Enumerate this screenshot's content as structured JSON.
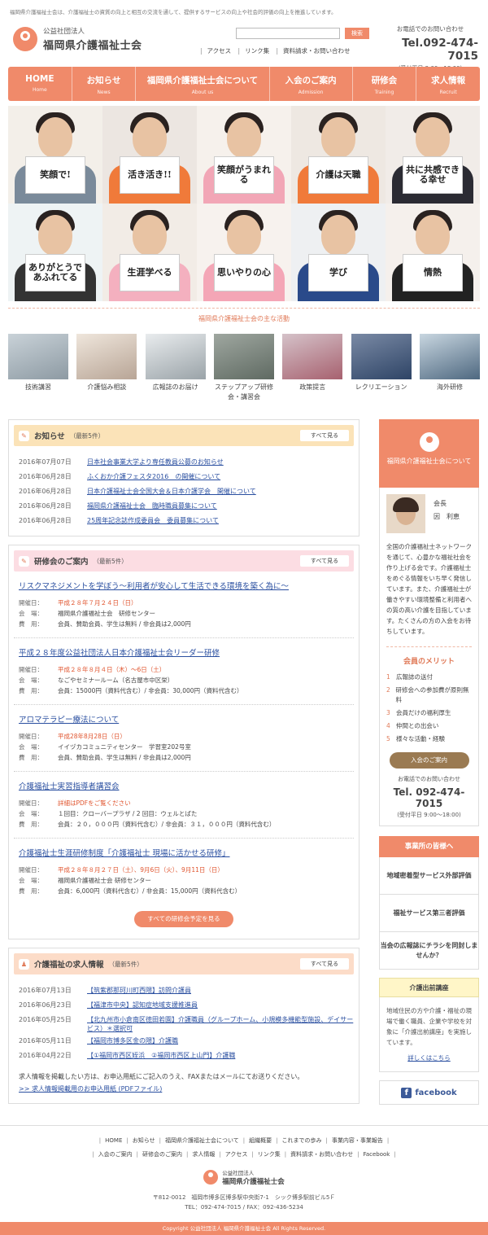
{
  "tagline": "福岡県介護福祉士会は、介護福祉士の資質の向上と相互の交流を通して、提供するサービスの向上や社会的評価の向上を推進しています。",
  "header": {
    "logo_sub": "公益社団法人",
    "logo_main": "福岡県介護福祉士会",
    "search_placeholder": "",
    "search_button": "検索",
    "util_links": [
      "アクセス",
      "リンク集",
      "資料請求・お問い合わせ"
    ],
    "contact_label": "お電話でのお問い合わせ",
    "tel": "Tel.092-474-7015",
    "hours": "(受付平日 9:00～18:00)"
  },
  "nav": [
    {
      "jp": "HOME",
      "en": "Home"
    },
    {
      "jp": "お知らせ",
      "en": "News"
    },
    {
      "jp": "福岡県介護福祉士会について",
      "en": "About us"
    },
    {
      "jp": "入会のご案内",
      "en": "Admission"
    },
    {
      "jp": "研修会",
      "en": "Training"
    },
    {
      "jp": "求人情報",
      "en": "Recruit"
    }
  ],
  "hero_signs": [
    "笑顔で!",
    "活き活き!!",
    "笑顔がうまれる",
    "介護は天職",
    "共に共感できる幸せ",
    "ありがとうであふれてる",
    "生涯学べる",
    "思いやりの心",
    "学び",
    "情熱"
  ],
  "colors": {
    "accent": "#f08a6a",
    "hero_bg": [
      "#f3efe9",
      "#ece6e1",
      "#f6f1ec",
      "#eee8e2",
      "#f1ece8",
      "#eef3f4",
      "#f2ece6",
      "#f7f2ee",
      "#eef0f2",
      "#f5f0ec"
    ],
    "hero_shirt": [
      "#7a8a9a",
      "#f07a3a",
      "#f2a6b6",
      "#f07a3a",
      "#2b2b33",
      "#333333",
      "#f4b0bf",
      "#f4a6b6",
      "#2a4a8a",
      "#222222"
    ]
  },
  "activities": {
    "title": "福岡県介護福祉士会の主な活動",
    "items": [
      "技術講習",
      "介護悩み相談",
      "広報誌のお届け",
      "ステップアップ研修会・講習会",
      "政策提言",
      "レクリエーション",
      "海外研修"
    ]
  },
  "news": {
    "title": "お知らせ",
    "sub": "（最新5件）",
    "all": "すべて見る",
    "items": [
      {
        "date": "2016年07月07日",
        "title": "日本社会事業大学より専任教員公募のお知らせ"
      },
      {
        "date": "2016年06月28日",
        "title": "ふくおか介護フェスタ2016　の開催について"
      },
      {
        "date": "2016年06月28日",
        "title": "日本介護福祉士会全国大会＆日本介護学会　開催について"
      },
      {
        "date": "2016年06月28日",
        "title": "福岡県介護福祉士会　臨時職員募集について"
      },
      {
        "date": "2016年06月28日",
        "title": "25周年記念誌作成委員会　委員募集について"
      }
    ]
  },
  "seminars": {
    "title": "研修会のご案内",
    "sub": "（最新5件）",
    "all": "すべて見る",
    "label_date": "開催日：",
    "label_place": "会　場：",
    "label_fee": "費　用：",
    "items": [
      {
        "title": "リスクマネジメントを学ぼう～利用者が安心して生活できる環境を築く為に～",
        "date": "平成２８年７月２４日（日）",
        "place": "福岡県介護福祉士会　研修センター",
        "fee": "会員、賛助会員、学生は無料 / 非会員は2,000円"
      },
      {
        "title": "平成２８年度公益社団法人日本介護福祉士会リーダー研修",
        "date": "平成２８年８月４日（木）～6日（土）",
        "place": "なごやセミナールーム（名古屋市中区栄）",
        "fee": "会員：15000円（資料代含む）/ 非会員：30,000円（資料代含む）"
      },
      {
        "title": "アロマテラピー療法について",
        "date": "平成28年8月28日（日）",
        "place": "イイヅカコミュニティセンター　学習室202号室",
        "fee": "会員、賛助会員、学生は無料 / 非会員は2,000円"
      },
      {
        "title": "介護福祉士実習指導者講習会",
        "date": "詳細はPDFをご覧ください",
        "place": "１回目：クローバープラザ / 2 回目：ウェルとばた",
        "fee": "会員：２０，０００円（資料代含む）/ 非会員：３１，０００円（資料代含む）"
      },
      {
        "title": "介護福祉士生涯研修制度「介護福祉士 現場に活かせる研修」",
        "date": "平成２８年８月２７日（土）、9月6日（火）、9月11日（日）",
        "place": "福岡県介護福祉士会 研修センター",
        "fee": "会員：6,000円（資料代含む）/ 非会員：15,000円（資料代含む）"
      }
    ],
    "all_button": "すべての研修会予定を見る"
  },
  "jobs": {
    "title": "介護福祉の求人情報",
    "sub": "（最新5件）",
    "all": "すべて見る",
    "items": [
      {
        "date": "2016年07月13日",
        "title": "【筑紫郡那珂川町西隈】訪問介護員"
      },
      {
        "date": "2016年06月23日",
        "title": "【福津市中央】認知症地域支援推進員"
      },
      {
        "date": "2016年05月25日",
        "title": "【北九州市小倉南区徳田若園】介護職員（グループホーム、小規模多機能型施設、デイサービス）＊選択可"
      },
      {
        "date": "2016年05月11日",
        "title": "【福岡市博多区金の隈】介護職"
      },
      {
        "date": "2016年04月22日",
        "title": "【①福岡市西区姪浜　②福岡市西区上山門】介護職"
      }
    ],
    "note": "求人情報を掲載したい方は、お申込用紙にご記入のうえ、FAXまたはメールにてお送りください。",
    "note_link": ">> 求人情報掲載用のお申込用紙 (PDFファイル)"
  },
  "sidebar": {
    "about_title": "福岡県介護福祉士会について",
    "president_role": "会長",
    "president_name": "因　利恵",
    "about_text": "全国の介護福祉士ネットワークを通じて、心豊かな福祉社会を作り上げる会です。介護福祉士をめぐる情報をいち早く発信しています。また、介護福祉士が働きやすい環境整備と利用者への質の高い介護を目指しています。たくさんの方の入会をお待ちしています。",
    "merit_title": "会員のメリット",
    "merits": [
      "広報誌の送付",
      "研修会への参加費が原則無料",
      "会員だけの福利厚生",
      "仲間との出会い",
      "様々な活動・経験"
    ],
    "join_button": "入会のご案内",
    "contact_label": "お電話でのお問い合わせ",
    "tel": "Tel. 092-474-7015",
    "hours": "(受付平日 9:00～18:00)",
    "eval_title": "事業所の皆様へ",
    "eval_items": [
      "地域密着型サービス外部評価",
      "福祉サービス第三者評価",
      "当会の広報誌にチラシを同封しませんか？"
    ],
    "deli_title": "介護出前講座",
    "deli_text": "地域住民の方や介護・福祉の現場で働く職員、企業や学校を対象に「介護出前講座」を実施しています。",
    "deli_link": "詳しくはこちら",
    "facebook": "facebook"
  },
  "footer": {
    "links": [
      "HOME",
      "お知らせ",
      "福岡県介護福祉士会について",
      "組織概要",
      "これまでの歩み",
      "事業内容・事業報告",
      "入会のご案内",
      "研修会のご案内",
      "求人情報",
      "アクセス",
      "リンク集",
      "資料請求・お問い合わせ",
      "Facebook"
    ],
    "logo_sub": "公益社団法人",
    "logo_main": "福岡県介護福祉士会",
    "address": "〒812-0012　福岡市博多区博多駅中央街7-1　シック博多駅前ビル5Ｆ",
    "tel_fax": "TEL：092-474-7015 / FAX：092-436-5234",
    "copyright": "Copyright  公益社団法人 福岡県介護福祉士会 All Rights Reserved."
  }
}
